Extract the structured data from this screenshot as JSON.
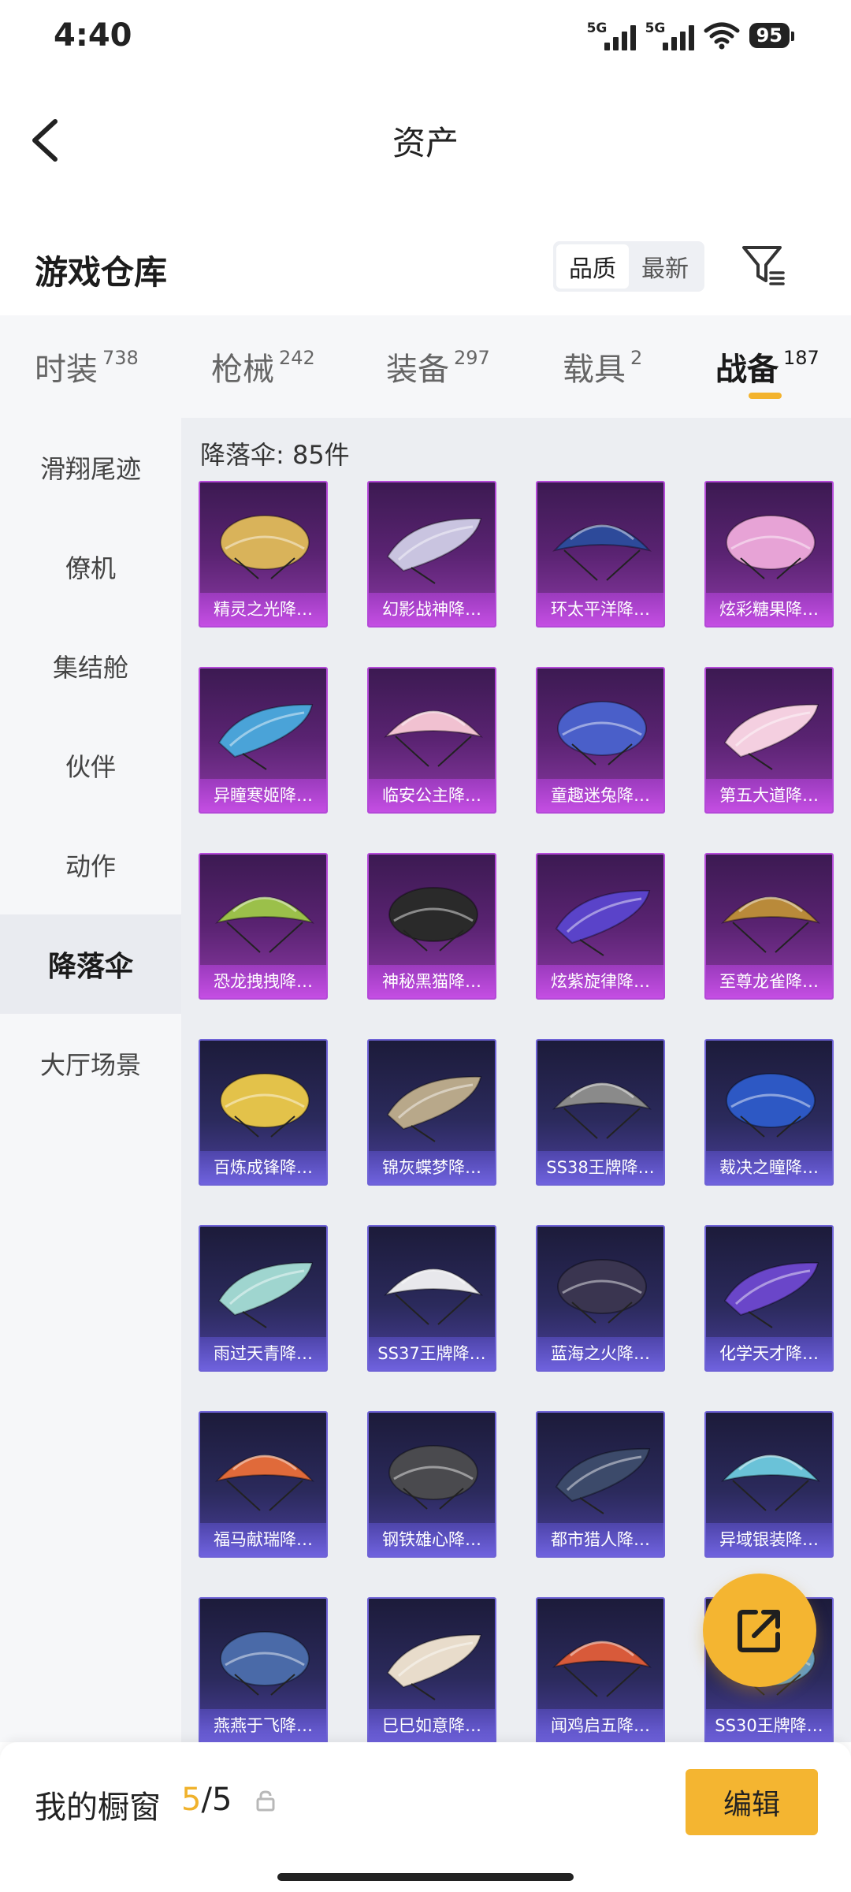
{
  "status_bar": {
    "time": "4:40",
    "signal1": "5G",
    "signal2": "5G",
    "battery": "95"
  },
  "header": {
    "title": "资产"
  },
  "warehouse": {
    "title": "游戏仓库",
    "sort_options": [
      "品质",
      "最新"
    ],
    "sort_active": "品质"
  },
  "tabs": [
    {
      "label": "时装",
      "count": "738"
    },
    {
      "label": "枪械",
      "count": "242"
    },
    {
      "label": "装备",
      "count": "297"
    },
    {
      "label": "载具",
      "count": "2"
    },
    {
      "label": "战备",
      "count": "187"
    }
  ],
  "active_tab": "战备",
  "sidebar": {
    "items": [
      "滑翔尾迹",
      "僚机",
      "集结舱",
      "伙伴",
      "动作",
      "降落伞",
      "大厅场景"
    ],
    "active": "降落伞"
  },
  "grid": {
    "count_label": "降落伞: 85件",
    "items": [
      {
        "name": "精灵之光降…",
        "rarity": "purple",
        "color": "#d9b35a"
      },
      {
        "name": "幻影战神降…",
        "rarity": "purple",
        "color": "#c9c4e0"
      },
      {
        "name": "环太平洋降…",
        "rarity": "purple",
        "color": "#2d4a9a"
      },
      {
        "name": "炫彩糖果降…",
        "rarity": "purple",
        "color": "#e7a3d6"
      },
      {
        "name": "异瞳寒姬降…",
        "rarity": "purple",
        "color": "#4aa3d8"
      },
      {
        "name": "临安公主降…",
        "rarity": "purple",
        "color": "#f1c1d1"
      },
      {
        "name": "童趣迷兔降…",
        "rarity": "purple",
        "color": "#4a5fc9"
      },
      {
        "name": "第五大道降…",
        "rarity": "purple",
        "color": "#f4cfe0"
      },
      {
        "name": "恐龙拽拽降…",
        "rarity": "purple",
        "color": "#9bc04a"
      },
      {
        "name": "神秘黑猫降…",
        "rarity": "purple",
        "color": "#2a2a2a"
      },
      {
        "name": "炫紫旋律降…",
        "rarity": "purple",
        "color": "#5a43c9"
      },
      {
        "name": "至尊龙雀降…",
        "rarity": "purple",
        "color": "#b98a3a"
      },
      {
        "name": "百炼成锋降…",
        "rarity": "blue",
        "color": "#e3c24a"
      },
      {
        "name": "锦灰蝶梦降…",
        "rarity": "blue",
        "color": "#b8a88a"
      },
      {
        "name": "SS38王牌降…",
        "rarity": "blue",
        "color": "#8a8a8a"
      },
      {
        "name": "裁决之瞳降…",
        "rarity": "blue",
        "color": "#2d58c4"
      },
      {
        "name": "雨过天青降…",
        "rarity": "blue",
        "color": "#9fd5cf"
      },
      {
        "name": "SS37王牌降…",
        "rarity": "blue",
        "color": "#e8e8ec"
      },
      {
        "name": "蓝海之火降…",
        "rarity": "blue",
        "color": "#3a3550"
      },
      {
        "name": "化学天才降…",
        "rarity": "blue",
        "color": "#6a46c9"
      },
      {
        "name": "福马献瑞降…",
        "rarity": "blue",
        "color": "#e06a3a"
      },
      {
        "name": "钢铁雄心降…",
        "rarity": "blue",
        "color": "#4a4a4e"
      },
      {
        "name": "都市猎人降…",
        "rarity": "blue",
        "color": "#3c4a6a"
      },
      {
        "name": "异域银装降…",
        "rarity": "blue",
        "color": "#6ac2d8"
      },
      {
        "name": "燕燕于飞降…",
        "rarity": "blue",
        "color": "#4a6aa8"
      },
      {
        "name": "巳巳如意降…",
        "rarity": "blue",
        "color": "#e8dccb"
      },
      {
        "name": "闻鸡启五降…",
        "rarity": "blue",
        "color": "#d85a3a"
      },
      {
        "name": "SS30王牌降…",
        "rarity": "blue",
        "color": "#5aa0d8"
      }
    ]
  },
  "showcase": {
    "label": "我的橱窗",
    "current": "5",
    "separator": "/",
    "total": "5"
  },
  "edit_button": "编辑",
  "icons": {
    "back": "back-arrow-icon",
    "filter": "filter-icon",
    "share": "share-icon",
    "lock": "lock-icon"
  },
  "colors": {
    "accent": "#f4b531",
    "purple_rarity": "#b449d8",
    "blue_rarity": "#6e62d6"
  }
}
